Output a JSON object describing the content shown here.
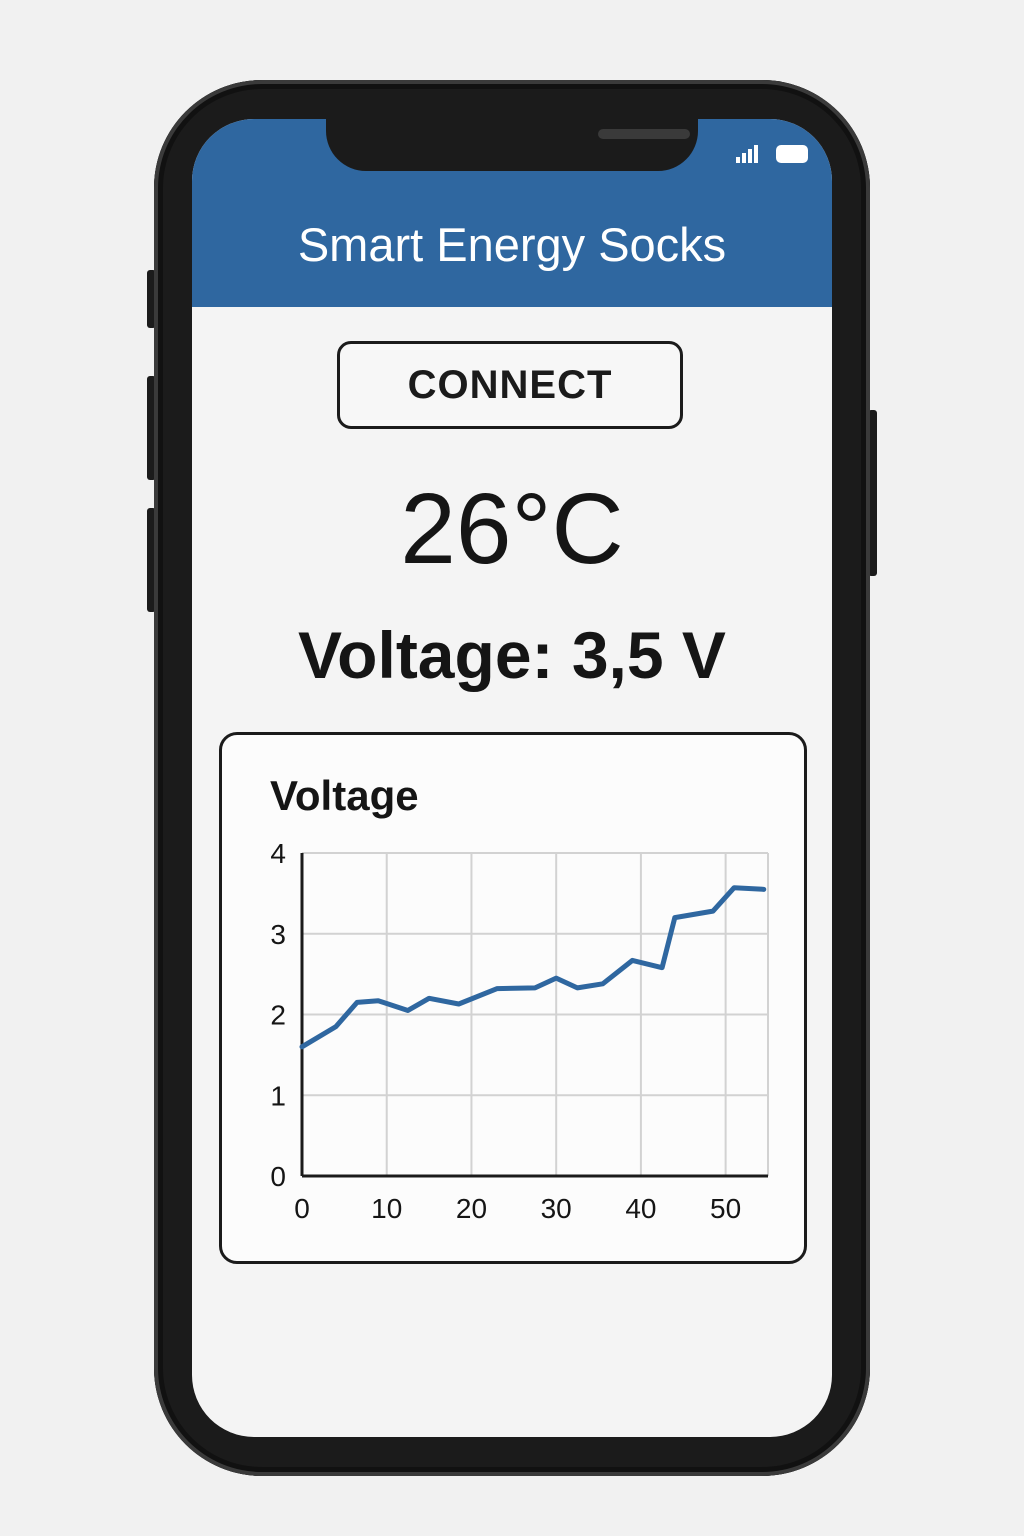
{
  "app": {
    "title": "Smart Energy Socks",
    "connect_label": "CONNECT",
    "temperature": "26°C",
    "voltage_readout": "Voltage: 3,5 V"
  },
  "status_bar": {
    "icons": [
      "signal-icon",
      "battery-icon"
    ]
  },
  "colors": {
    "header": "#2f67a0",
    "line": "#2f67a0",
    "background": "#f4f4f4"
  },
  "chart_data": {
    "type": "line",
    "title": "Voltage",
    "xlabel": "",
    "ylabel": "",
    "xlim": [
      0,
      55
    ],
    "ylim": [
      0,
      4
    ],
    "x_ticks": [
      0,
      10,
      20,
      30,
      40,
      50
    ],
    "y_ticks": [
      0,
      1,
      2,
      3,
      4
    ],
    "grid": true,
    "series": [
      {
        "x": [
          0,
          4,
          6.5,
          9,
          12.5,
          15,
          18.5,
          23,
          27.5,
          30,
          32.5,
          35.5,
          39,
          42.5,
          44,
          48.5,
          51,
          54.5
        ],
        "y": [
          1.6,
          1.85,
          2.15,
          2.17,
          2.05,
          2.2,
          2.13,
          2.32,
          2.33,
          2.45,
          2.33,
          2.38,
          2.67,
          2.58,
          3.2,
          3.28,
          3.57,
          3.55
        ]
      }
    ]
  }
}
